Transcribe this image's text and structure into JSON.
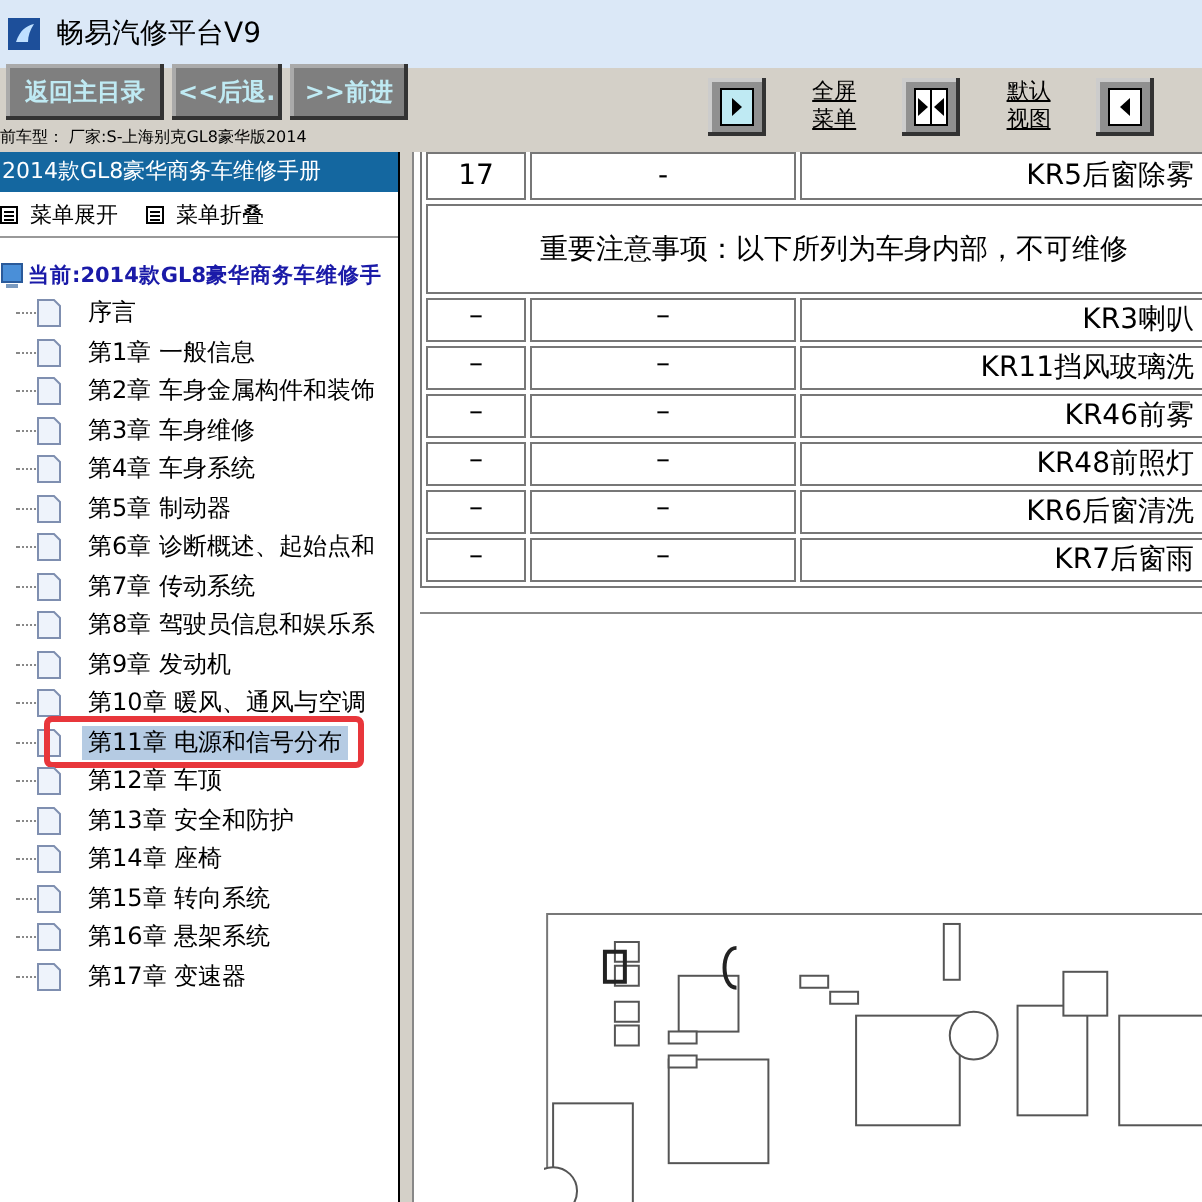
{
  "window": {
    "title": "畅易汽修平台V9"
  },
  "toolbar": {
    "buttons": [
      "返回主目录",
      "<<后退.",
      ">>前进"
    ],
    "car_model": "前车型： 厂家:S-上海别克GL8豪华版2014",
    "view_controls": [
      {
        "kind": "icon"
      },
      {
        "kind": "link",
        "label": "全屏菜单"
      },
      {
        "kind": "icon"
      },
      {
        "kind": "link",
        "label": "默认视图"
      },
      {
        "kind": "icon"
      }
    ]
  },
  "sidebar": {
    "header": "2014款GL8豪华商务车维修手册",
    "actions": [
      "菜单展开",
      "菜单折叠"
    ],
    "tree": {
      "label": "当前:2014款GL8豪华商务车维修手",
      "children": [
        {
          "label": "序言",
          "selected": false
        },
        {
          "label": "第1章 一般信息",
          "selected": false
        },
        {
          "label": "第2章 车身金属构件和装饰",
          "selected": false
        },
        {
          "label": "第3章 车身维修",
          "selected": false
        },
        {
          "label": "第4章 车身系统",
          "selected": false
        },
        {
          "label": "第5章 制动器",
          "selected": false
        },
        {
          "label": "第6章 诊断概述、起始点和",
          "selected": false
        },
        {
          "label": "第7章 传动系统",
          "selected": false
        },
        {
          "label": "第8章 驾驶员信息和娱乐系",
          "selected": false
        },
        {
          "label": "第9章 发动机",
          "selected": false
        },
        {
          "label": "第10章 暖风、通风与空调",
          "selected": false
        },
        {
          "label": "第11章 电源和信号分布",
          "selected": true
        },
        {
          "label": "第12章 车顶",
          "selected": false
        },
        {
          "label": "第13章 安全和防护",
          "selected": false
        },
        {
          "label": "第14章 座椅",
          "selected": false
        },
        {
          "label": "第15章 转向系统",
          "selected": false
        },
        {
          "label": "第16章 悬架系统",
          "selected": false
        },
        {
          "label": "第17章 变速器",
          "selected": false
        }
      ]
    }
  },
  "document": {
    "table": {
      "rows": [
        {
          "kind": "row",
          "cells": [
            "17",
            "-",
            "KR5后窗除雾"
          ]
        },
        {
          "kind": "note",
          "text": "重要注意事项：以下所列为车身内部，不可维修"
        },
        {
          "kind": "row",
          "cells": [
            "–",
            "–",
            "KR3喇叭"
          ]
        },
        {
          "kind": "row",
          "cells": [
            "–",
            "–",
            "KR11挡风玻璃洗"
          ]
        },
        {
          "kind": "row",
          "cells": [
            "–",
            "–",
            "KR46前雾"
          ]
        },
        {
          "kind": "row",
          "cells": [
            "–",
            "–",
            "KR48前照灯"
          ]
        },
        {
          "kind": "row",
          "cells": [
            "–",
            "–",
            "KR6后窗清洗"
          ]
        },
        {
          "kind": "row",
          "cells": [
            "–",
            "–",
            "KR7后窗雨"
          ]
        }
      ]
    }
  }
}
